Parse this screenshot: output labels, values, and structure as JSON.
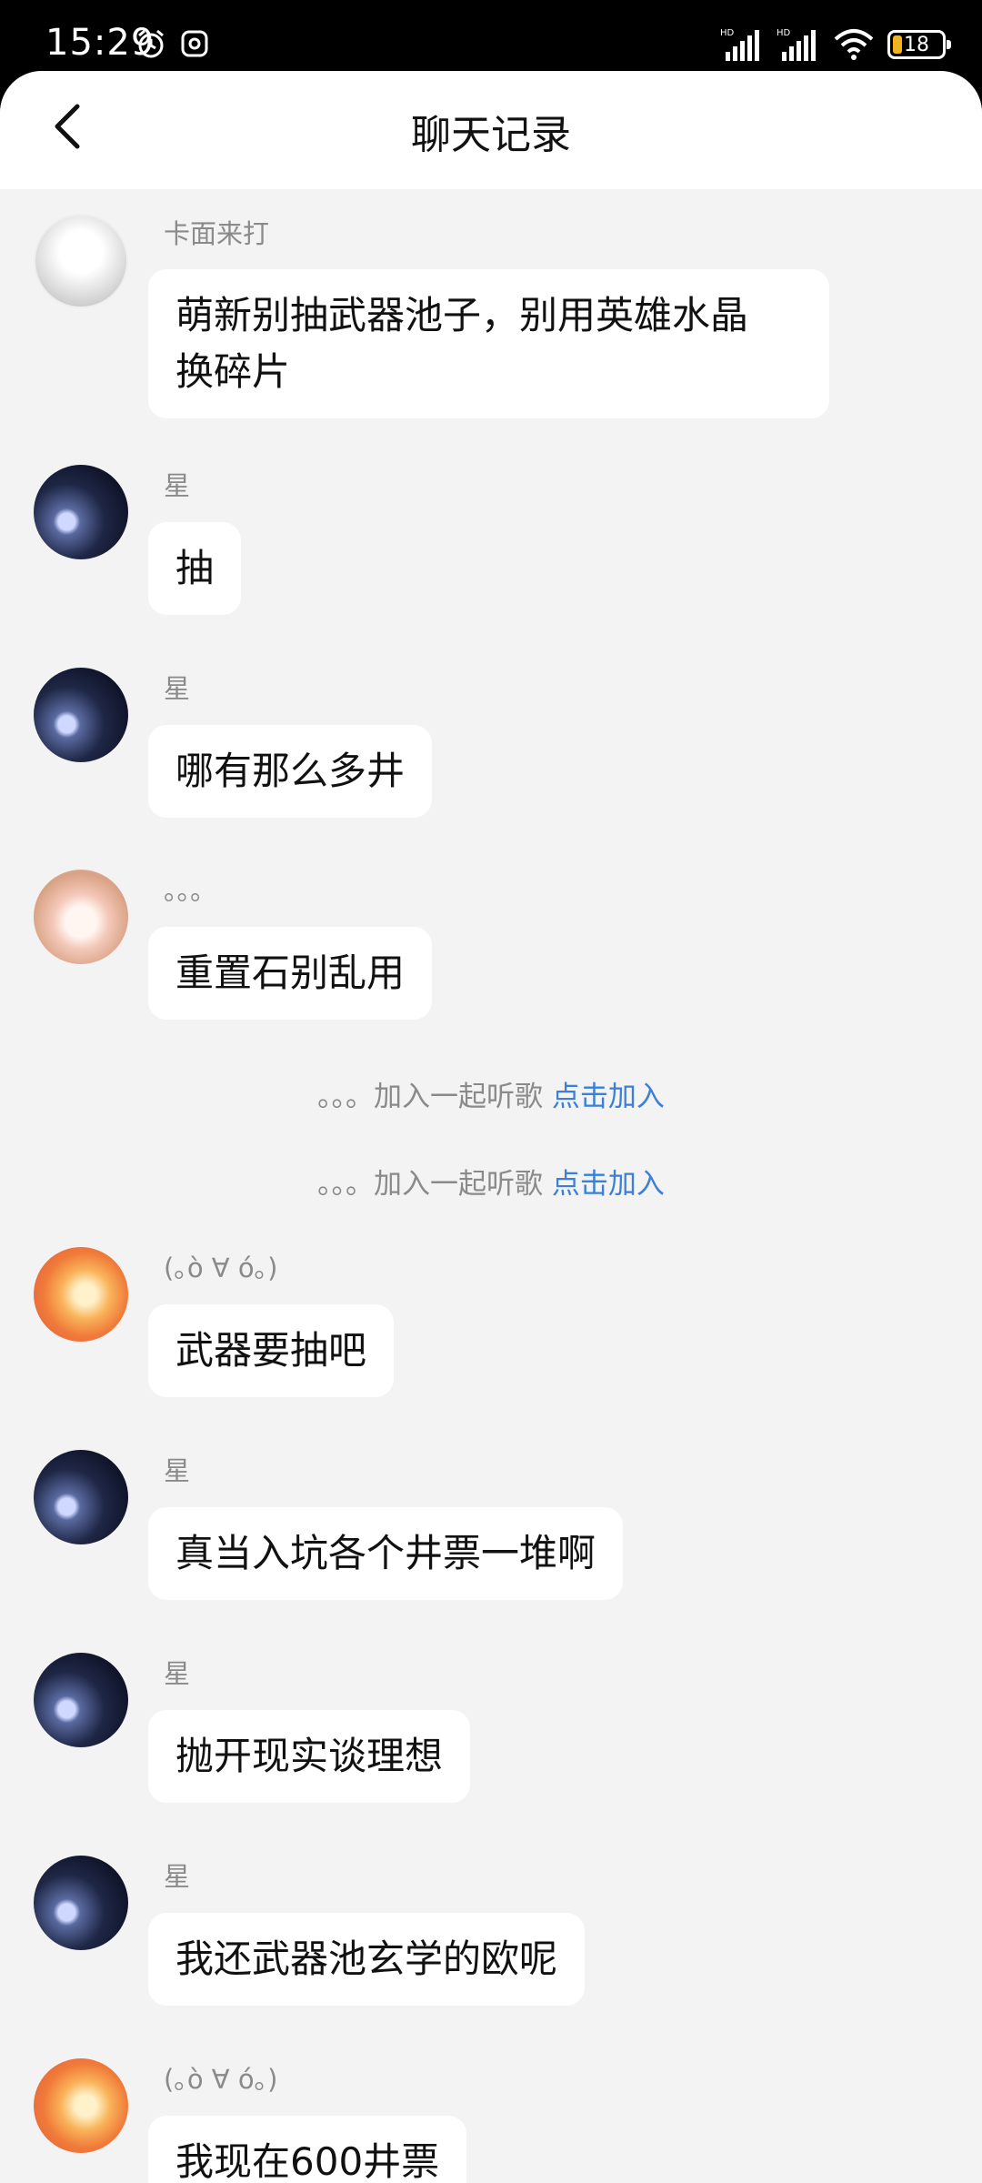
{
  "status_bar": {
    "time": "15:29",
    "battery": "18",
    "icons": [
      "alarm-icon",
      "settings-icon",
      "signal-hd-icon",
      "signal-hd-icon",
      "wifi-icon",
      "battery-icon"
    ]
  },
  "header": {
    "title": "聊天记录",
    "back_icon": "chevron-left-icon"
  },
  "messages": [
    {
      "sender": "卡面来打",
      "text": "萌新别抽武器池子，别用英雄水晶\n换碎片"
    },
    {
      "sender": "星",
      "text": "抽"
    },
    {
      "sender": "星",
      "text": "哪有那么多井"
    },
    {
      "sender": "。。。",
      "text": "重置石别乱用"
    },
    {
      "sender": "(｡ò ∀ ó｡)",
      "text": "武器要抽吧"
    },
    {
      "sender": "星",
      "text": "真当入坑各个井票一堆啊"
    },
    {
      "sender": "星",
      "text": "抛开现实谈理想"
    },
    {
      "sender": "星",
      "text": "我还武器池玄学的欧呢"
    },
    {
      "sender": "(｡ò ∀ ó｡)",
      "text": "我现在600井票"
    }
  ],
  "system_notices": [
    {
      "text": "。。。加入一起听歌",
      "link": "点击加入"
    },
    {
      "text": "。。。加入一起听歌",
      "link": "点击加入"
    }
  ],
  "colors": {
    "background": "#f3f3f3",
    "bubble": "#ffffff",
    "link": "#3b7fd9",
    "battery_fill": "#f3b31d"
  }
}
